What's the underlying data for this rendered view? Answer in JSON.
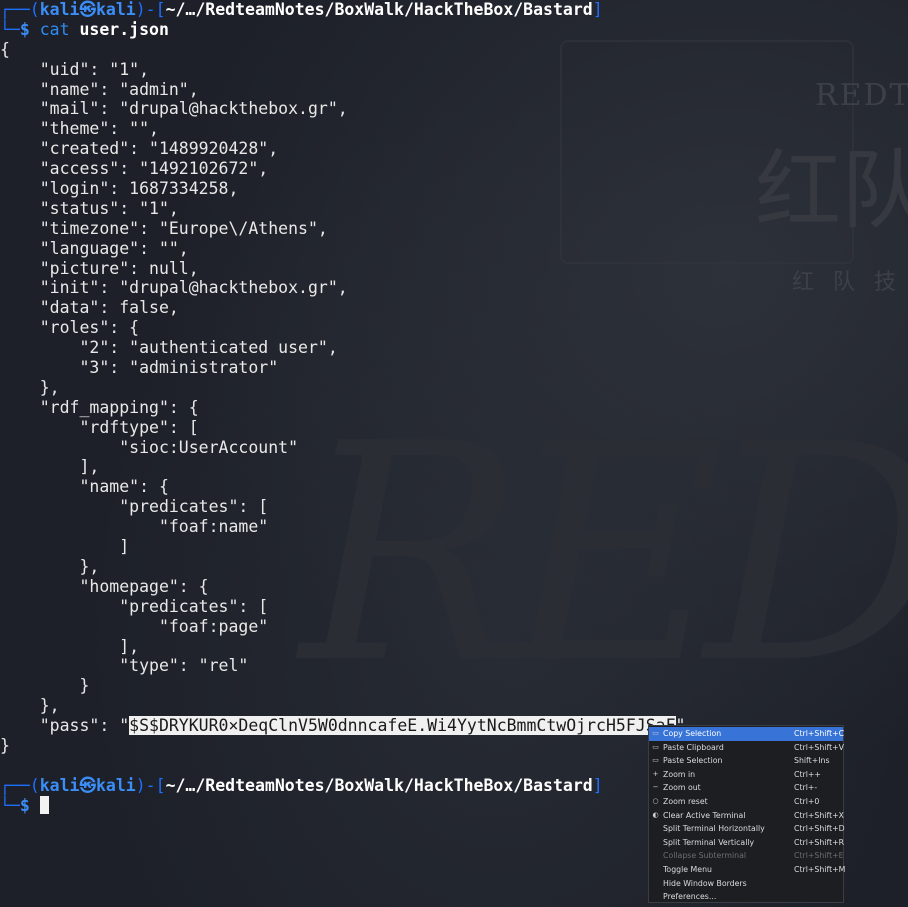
{
  "prompt": {
    "user": "kali",
    "host": "kali",
    "path": "~/…/RedteamNotes/BoxWalk/HackTheBox/Bastard"
  },
  "command": {
    "name": "cat",
    "arg": "user.json"
  },
  "output": {
    "open_brace": "{",
    "lines_before_pass": [
      "    \"uid\": \"1\",",
      "    \"name\": \"admin\",",
      "    \"mail\": \"drupal@hackthebox.gr\",",
      "    \"theme\": \"\",",
      "    \"created\": \"1489920428\",",
      "    \"access\": \"1492102672\",",
      "    \"login\": 1687334258,",
      "    \"status\": \"1\",",
      "    \"timezone\": \"Europe\\/Athens\",",
      "    \"language\": \"\",",
      "    \"picture\": null,",
      "    \"init\": \"drupal@hackthebox.gr\",",
      "    \"data\": false,",
      "    \"roles\": {",
      "        \"2\": \"authenticated user\",",
      "        \"3\": \"administrator\"",
      "    },",
      "    \"rdf_mapping\": {",
      "        \"rdftype\": [",
      "            \"sioc:UserAccount\"",
      "        ],",
      "        \"name\": {",
      "            \"predicates\": [",
      "                \"foaf:name\"",
      "            ]",
      "        },",
      "        \"homepage\": {",
      "            \"predicates\": [",
      "                \"foaf:page\"",
      "            ],",
      "            \"type\": \"rel\"",
      "        }",
      "    },"
    ],
    "pass_prefix": "    \"pass\": \"",
    "pass_value": "$S$DRYKUR0×DeqClnV5W0dnncafeE.Wi4YytNcBmmCtwOjrcH5FJSaF",
    "pass_suffix": "\"",
    "close_brace": "}"
  },
  "context_menu": {
    "items": [
      {
        "label": "Copy Selection",
        "shortcut": "Ctrl+Shift+C",
        "icon": "copy-icon",
        "highlighted": true
      },
      {
        "label": "Paste Clipboard",
        "shortcut": "Ctrl+Shift+V",
        "icon": "paste-icon"
      },
      {
        "label": "Paste Selection",
        "shortcut": "Shift+Ins",
        "icon": "paste-selection-icon"
      },
      {
        "label": "Zoom in",
        "shortcut": "Ctrl++",
        "icon": "zoom-in-icon"
      },
      {
        "label": "Zoom out",
        "shortcut": "Ctrl+-",
        "icon": "zoom-out-icon"
      },
      {
        "label": "Zoom reset",
        "shortcut": "Ctrl+0",
        "icon": "zoom-reset-icon"
      },
      {
        "label": "Clear Active Terminal",
        "shortcut": "Ctrl+Shift+X",
        "icon": "clear-icon"
      },
      {
        "label": "Split Terminal Horizontally",
        "shortcut": "Ctrl+Shift+D",
        "icon": ""
      },
      {
        "label": "Split Terminal Vertically",
        "shortcut": "Ctrl+Shift+R",
        "icon": ""
      },
      {
        "label": "Collapse Subterminal",
        "shortcut": "Ctrl+Shift+E",
        "icon": "",
        "disabled": true
      },
      {
        "label": "Toggle Menu",
        "shortcut": "Ctrl+Shift+M",
        "icon": ""
      },
      {
        "label": "Hide Window Borders",
        "shortcut": "",
        "icon": ""
      },
      {
        "label": "Preferences...",
        "shortcut": "",
        "icon": ""
      }
    ]
  },
  "watermark": {
    "title": "REDT",
    "big": "红队",
    "sub": "红 队 技",
    "large": "RED"
  },
  "colors": {
    "background": "#1d2028",
    "prompt_blue": "#3b8ef7",
    "menu_highlight": "#3874d8"
  }
}
